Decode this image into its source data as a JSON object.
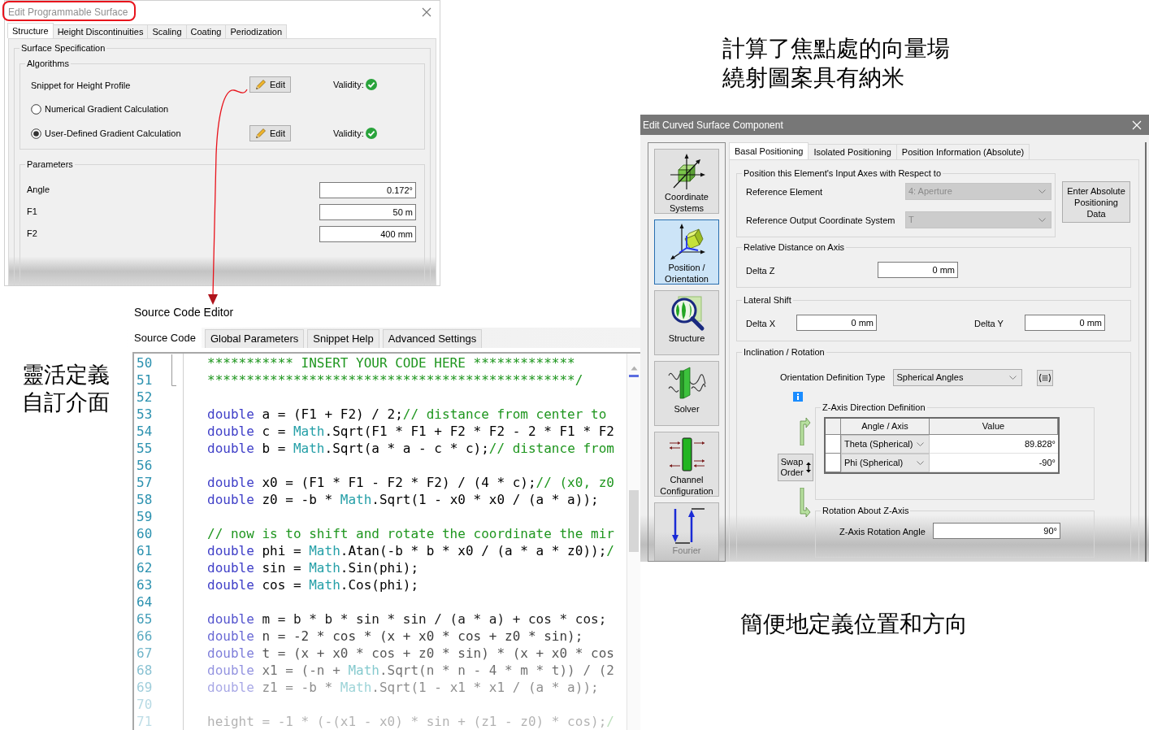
{
  "programmable_surface_dialog": {
    "title": "Edit Programmable Surface",
    "tabs": [
      {
        "label": "Structure",
        "selected": true
      },
      {
        "label": "Height Discontinuities",
        "selected": false
      },
      {
        "label": "Scaling",
        "selected": false
      },
      {
        "label": "Coating",
        "selected": false
      },
      {
        "label": "Periodization",
        "selected": false
      }
    ],
    "surface_specification": {
      "title": "Surface Specification",
      "algorithms": {
        "title": "Algorithms",
        "rows": [
          {
            "kind": "label",
            "label": "Snippet for Height Profile",
            "edit_button": "Edit",
            "validity_label": "Validity:",
            "valid": true
          },
          {
            "kind": "radio",
            "label": "Numerical Gradient Calculation",
            "selected": false
          },
          {
            "kind": "radio",
            "label": "User-Defined Gradient Calculation",
            "selected": true,
            "edit_button": "Edit",
            "validity_label": "Validity:",
            "valid": true
          }
        ]
      },
      "parameters": {
        "title": "Parameters",
        "rows": [
          {
            "label": "Angle",
            "value": "0.172°"
          },
          {
            "label": "F1",
            "value": "50 m"
          },
          {
            "label": "F2",
            "value": "400 mm"
          }
        ]
      }
    }
  },
  "caption_top": {
    "lines": [
      "計算了焦點處的向量場",
      "繞射圖案具有納米"
    ]
  },
  "curved_surface_dialog": {
    "title": "Edit Curved Surface Component",
    "sidebar": [
      {
        "label": "Coordinate Systems",
        "selected": false
      },
      {
        "label": "Position / Orientation",
        "selected": true
      },
      {
        "label": "Structure",
        "selected": false
      },
      {
        "label": "Solver",
        "selected": false
      },
      {
        "label": "Channel Configuration",
        "selected": false
      },
      {
        "label": "Fourier",
        "selected": false
      }
    ],
    "tabs": [
      {
        "label": "Basal Positioning",
        "selected": true
      },
      {
        "label": "Isolated Positioning",
        "selected": false
      },
      {
        "label": "Position Information (Absolute)",
        "selected": false
      }
    ],
    "reference": {
      "title": "Position this Element's Input Axes with Respect to",
      "fields": [
        {
          "label": "Reference Element",
          "value": "4: Aperture",
          "disabled": true
        },
        {
          "label": "Reference Output Coordinate System",
          "value": "T",
          "disabled": true
        }
      ]
    },
    "absolute_button": "Enter Absolute Positioning Data",
    "relative_distance": {
      "title": "Relative Distance on Axis",
      "fields": [
        {
          "label": "Delta Z",
          "value": "0 mm"
        }
      ]
    },
    "lateral_shift": {
      "title": "Lateral Shift",
      "fields": [
        {
          "label": "Delta X",
          "value": "0 mm"
        },
        {
          "label": "Delta Y",
          "value": "0 mm"
        }
      ]
    },
    "inclination": {
      "title": "Inclination / Rotation",
      "orientation_type": {
        "label": "Orientation Definition Type",
        "value": "Spherical Angles"
      },
      "swap_button": "Swap Order",
      "z_axis_direction": {
        "title": "Z-Axis Direction Definition",
        "columns": [
          "Angle / Axis",
          "Value"
        ],
        "rows": [
          {
            "axis": "Theta (Spherical)",
            "value": "89.828°"
          },
          {
            "axis": "Phi (Spherical)",
            "value": "-90°"
          }
        ]
      },
      "rotation": {
        "title": "Rotation About Z-Axis",
        "label": "Z-Axis Rotation Angle",
        "value": "90°"
      }
    }
  },
  "source_code_editor": {
    "title": "Source Code Editor",
    "tabs": [
      {
        "label": "Source Code",
        "selected": true
      },
      {
        "label": "Global Parameters",
        "selected": false
      },
      {
        "label": "Snippet Help",
        "selected": false
      },
      {
        "label": "Advanced Settings",
        "selected": false
      }
    ],
    "lines": [
      {
        "number": "50",
        "tokens": [
          {
            "kind": "comment",
            "text": "*********** INSERT YOUR CODE HERE *************"
          }
        ]
      },
      {
        "number": "51",
        "tokens": [
          {
            "kind": "comment",
            "text": "***********************************************/"
          }
        ]
      },
      {
        "number": "52"
      },
      {
        "number": "53",
        "tokens": [
          {
            "kind": "keyword",
            "text": "double"
          },
          {
            "kind": "plain",
            "text": " a = (F1 + F2) / 2;"
          },
          {
            "kind": "comment",
            "text": "// distance from center to"
          }
        ]
      },
      {
        "number": "54",
        "tokens": [
          {
            "kind": "keyword",
            "text": "double"
          },
          {
            "kind": "plain",
            "text": " c = "
          },
          {
            "kind": "type",
            "text": "Math"
          },
          {
            "kind": "plain",
            "text": ".Sqrt(F1 * F1 + F2 * F2 - 2 * F1 * F2"
          }
        ]
      },
      {
        "number": "55",
        "tokens": [
          {
            "kind": "keyword",
            "text": "double"
          },
          {
            "kind": "plain",
            "text": " b = "
          },
          {
            "kind": "type",
            "text": "Math"
          },
          {
            "kind": "plain",
            "text": ".Sqrt(a * a - c * c);"
          },
          {
            "kind": "comment",
            "text": "// distance from"
          }
        ]
      },
      {
        "number": "56"
      },
      {
        "number": "57",
        "tokens": [
          {
            "kind": "keyword",
            "text": "double"
          },
          {
            "kind": "plain",
            "text": " x0 = (F1 * F1 - F2 * F2) / (4 * c);"
          },
          {
            "kind": "comment",
            "text": "// (x0, z0"
          }
        ]
      },
      {
        "number": "58",
        "tokens": [
          {
            "kind": "keyword",
            "text": "double"
          },
          {
            "kind": "plain",
            "text": " z0 = -b * "
          },
          {
            "kind": "type",
            "text": "Math"
          },
          {
            "kind": "plain",
            "text": ".Sqrt(1 - x0 * x0 / (a * a));"
          }
        ]
      },
      {
        "number": "59"
      },
      {
        "number": "60",
        "tokens": [
          {
            "kind": "comment",
            "text": "// now is to shift and rotate the coordinate the mir"
          }
        ]
      },
      {
        "number": "61",
        "tokens": [
          {
            "kind": "keyword",
            "text": "double"
          },
          {
            "kind": "plain",
            "text": " phi = "
          },
          {
            "kind": "type",
            "text": "Math"
          },
          {
            "kind": "plain",
            "text": ".Atan(-b * b * x0 / (a * a * z0));"
          },
          {
            "kind": "comment",
            "text": "/"
          }
        ]
      },
      {
        "number": "62",
        "tokens": [
          {
            "kind": "keyword",
            "text": "double"
          },
          {
            "kind": "plain",
            "text": " sin = "
          },
          {
            "kind": "type",
            "text": "Math"
          },
          {
            "kind": "plain",
            "text": ".Sin(phi);"
          }
        ]
      },
      {
        "number": "63",
        "tokens": [
          {
            "kind": "keyword",
            "text": "double"
          },
          {
            "kind": "plain",
            "text": " cos = "
          },
          {
            "kind": "type",
            "text": "Math"
          },
          {
            "kind": "plain",
            "text": ".Cos(phi);"
          }
        ]
      },
      {
        "number": "64"
      },
      {
        "number": "65",
        "tokens": [
          {
            "kind": "keyword",
            "text": "double"
          },
          {
            "kind": "plain",
            "text": " m = b * b * sin * sin / (a * a) + cos * cos;"
          }
        ]
      },
      {
        "number": "66",
        "tokens": [
          {
            "kind": "keyword",
            "text": "double"
          },
          {
            "kind": "plain",
            "text": " n = -2 * cos * (x + x0 * cos + z0 * sin);"
          }
        ]
      },
      {
        "number": "67",
        "tokens": [
          {
            "kind": "keyword",
            "text": "double"
          },
          {
            "kind": "plain",
            "text": " t = (x + x0 * cos + z0 * sin) * (x + x0 * cos"
          }
        ]
      },
      {
        "number": "68",
        "tokens": [
          {
            "kind": "keyword",
            "text": "double"
          },
          {
            "kind": "plain",
            "text": " x1 = (-n + "
          },
          {
            "kind": "type",
            "text": "Math"
          },
          {
            "kind": "plain",
            "text": ".Sqrt(n * n - 4 * m * t)) / (2"
          }
        ]
      },
      {
        "number": "69",
        "tokens": [
          {
            "kind": "keyword",
            "text": "double"
          },
          {
            "kind": "plain",
            "text": " z1 = -b * "
          },
          {
            "kind": "type",
            "text": "Math"
          },
          {
            "kind": "plain",
            "text": ".Sqrt(1 - x1 * x1 / (a * a));"
          }
        ]
      },
      {
        "number": "70"
      },
      {
        "number": "71",
        "tokens": [
          {
            "kind": "plain",
            "text": "height = -1 * (-(x1 - x0) * sin + (z1 - z0) * cos);"
          },
          {
            "kind": "comment",
            "text": "/"
          }
        ]
      }
    ]
  },
  "caption_left": {
    "lines": [
      "靈活定義",
      "自訂介面"
    ]
  },
  "caption_bottom": {
    "lines": [
      "簡便地定義位置和方向"
    ]
  }
}
